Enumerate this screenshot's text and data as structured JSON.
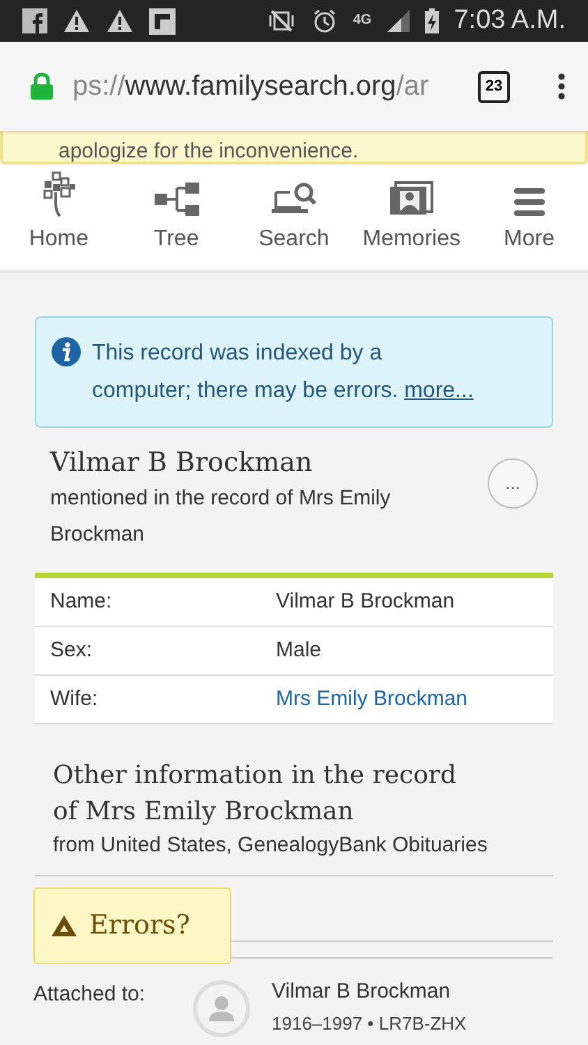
{
  "status_bar": {
    "time": "7:03 A.M.",
    "network": "4G"
  },
  "browser": {
    "url_faded_start": "ps://",
    "url_main": "www.familysearch.org",
    "url_faded_end": "/ar",
    "tab_count": "23"
  },
  "notice_banner": {
    "text": "apologize for the inconvenience."
  },
  "nav": [
    {
      "label": "Home"
    },
    {
      "label": "Tree"
    },
    {
      "label": "Search"
    },
    {
      "label": "Memories"
    },
    {
      "label": "More"
    }
  ],
  "info_box": {
    "text": "This record was indexed by a computer; there may be errors.",
    "link": "more..."
  },
  "person": {
    "name": "Vilmar B Brockman",
    "subtitle": "mentioned in the record of Mrs Emily Brockman",
    "menu_button": "..."
  },
  "facts": [
    {
      "label": "Name:",
      "value": "Vilmar B Brockman",
      "kind": "text"
    },
    {
      "label": "Sex:",
      "value": "Male",
      "kind": "text"
    },
    {
      "label": "Wife:",
      "value": "Mrs Emily Brockman",
      "kind": "link"
    }
  ],
  "other_info": {
    "title": "Other information in the record of Mrs Emily Brockman",
    "source": "from United States, GenealogyBank Obituaries"
  },
  "errors_button": {
    "label": "Errors?"
  },
  "attached": {
    "label": "Attached to:",
    "name": "Vilmar B Brockman",
    "details": "1916–1997 • LR7B-ZHX"
  }
}
